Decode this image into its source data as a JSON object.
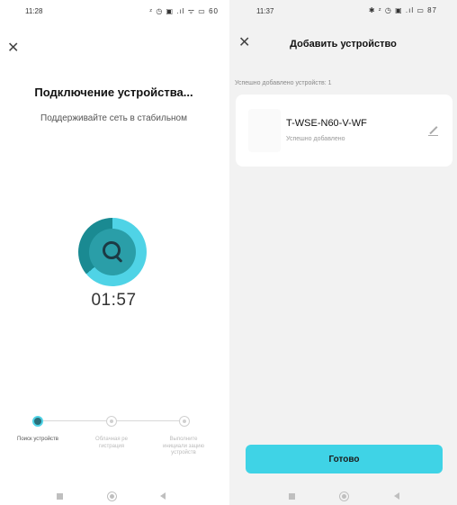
{
  "left": {
    "status": {
      "time": "11:28",
      "icons": "ᶻ ◷ ▣ .ıl ᯤ ▭ 60"
    },
    "close_glyph": "✕",
    "title": "Подключение устройства...",
    "subtitle": "Поддерживайте сеть в стабильном",
    "timer": "01:57",
    "steps": [
      {
        "label": "Поиск устройств",
        "state": "active"
      },
      {
        "label": "Облачная ре гистрация",
        "state": "pending"
      },
      {
        "label": "Выполните инициали зацию устройств",
        "state": "pending"
      }
    ]
  },
  "right": {
    "status": {
      "time": "11:37",
      "icons": "✱ ᶻ ◷ ▣ .ıl ▭ 87"
    },
    "close_glyph": "✕",
    "title": "Добавить устройство",
    "count_text": "Успешно добавлено устройств: 1",
    "device": {
      "name": "T-WSE-N60-V-WF",
      "status": "Успешно добавлено"
    },
    "done_label": "Готово"
  },
  "colors": {
    "accent": "#3fd3e6",
    "ring_dark": "#1a8a92",
    "ring_light": "#4fd3e6"
  },
  "icons": [
    "close-icon",
    "search-icon",
    "edit-icon",
    "nav-recents-icon",
    "nav-home-icon",
    "nav-back-icon"
  ]
}
